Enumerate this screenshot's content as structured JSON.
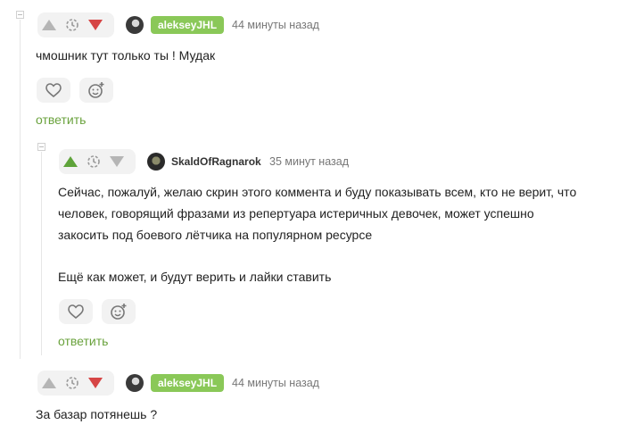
{
  "comments": [
    {
      "author": "alekseyJHL",
      "time": "44 минуты назад",
      "text": "чмошник тут только ты ! Мудак",
      "reply_label": "ответить"
    },
    {
      "author": "SkaldOfRagnarok",
      "time": "35 минут назад",
      "paragraph1_line1": "Сейчас, пожалуй, желаю скрин этого коммента и буду показывать всем, кто не верит, что",
      "paragraph1_line2": "человек, говорящий фразами из репертуара истеричных девочек, может успешно",
      "paragraph1_line3": "закосить под боевого лётчика на популярном ресурсе",
      "paragraph2": "Ещё как может, и будут верить и лайки ставить",
      "reply_label": "ответить"
    },
    {
      "author": "alekseyJHL",
      "time": "44 минуты назад",
      "text": "За базар потянешь ?"
    }
  ],
  "colors": {
    "upvote_active": "#5ea33a",
    "downvote_active": "#d64545",
    "vote_inactive": "#b5b5b5",
    "badge_bg": "#8ac858",
    "reply_link": "#6aa23d"
  },
  "icons": [
    "arrow-up-icon",
    "clock-icon",
    "arrow-down-icon",
    "heart-icon",
    "smile-plus-icon",
    "collapse-icon"
  ]
}
